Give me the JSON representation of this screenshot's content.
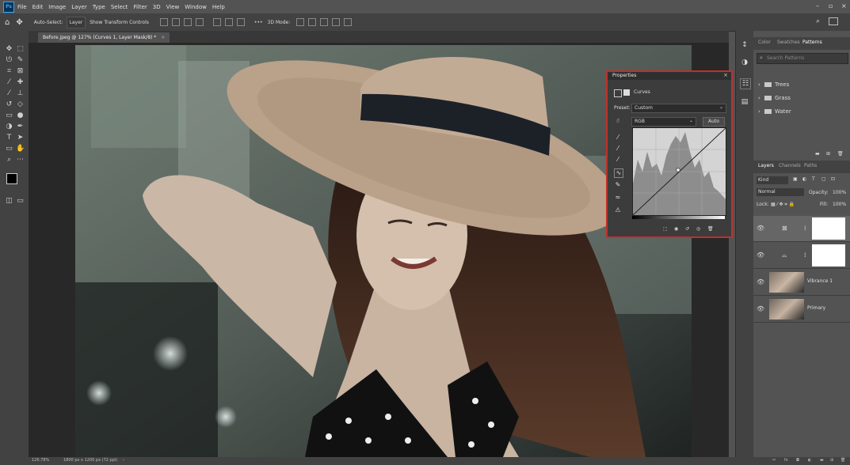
{
  "app": {
    "icon_text": "Ps"
  },
  "menu": [
    "File",
    "Edit",
    "Image",
    "Layer",
    "Type",
    "Select",
    "Filter",
    "3D",
    "View",
    "Window",
    "Help"
  ],
  "options_bar": {
    "auto_select_label": "Auto-Select:",
    "auto_select_value": "Layer",
    "show_transform_label": "Show Transform Controls",
    "mode_3d": "3D Mode:"
  },
  "document_tab": {
    "title": "Before.jpeg @ 127% (Curves 1, Layer Mask/8) *"
  },
  "status": {
    "zoom": "126.78%",
    "doc_info": "1800 px x 1200 px (72 ppi)"
  },
  "properties_panel": {
    "title": "Properties",
    "adjustment_type": "Curves",
    "preset_label": "Preset:",
    "preset_value": "Custom",
    "channel_value": "RGB",
    "auto_button": "Auto"
  },
  "right_panel": {
    "top_tabs": [
      "Color",
      "Swatches",
      "Patterns"
    ],
    "active_top_tab": "Patterns",
    "search_placeholder": "Search Patterns",
    "folders": [
      "Trees",
      "Grass",
      "Water"
    ],
    "layer_tabs": [
      "Layers",
      "Channels",
      "Paths"
    ],
    "kind_filter": "Kind",
    "blend_mode": "Normal",
    "opacity_label": "Opacity:",
    "opacity_value": "100%",
    "lock_label": "Lock:",
    "fill_label": "Fill:",
    "fill_value": "100%",
    "layers": [
      {
        "name": "",
        "type": "curves"
      },
      {
        "name": "",
        "type": "levels"
      },
      {
        "name": "Vibrance 1",
        "type": "image"
      },
      {
        "name": "Primary",
        "type": "image"
      }
    ]
  },
  "colors": {
    "accent_red": "#c0302b",
    "ps_blue": "#31a8ff"
  }
}
